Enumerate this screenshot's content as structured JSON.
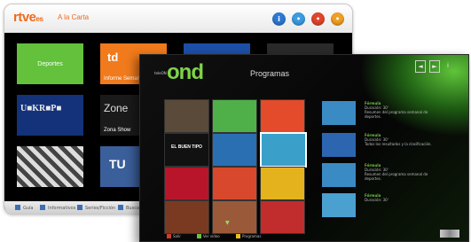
{
  "rtve": {
    "logo": "rtve",
    "logo_suffix": "es",
    "title": "A la Carta",
    "header_icons": [
      {
        "name": "info-icon",
        "glyph": "i",
        "color": "#2e79d4"
      },
      {
        "name": "globe-icon",
        "glyph": "•",
        "color": "#3d9be0"
      },
      {
        "name": "record-icon",
        "glyph": "•",
        "color": "#e0462d"
      },
      {
        "name": "home-icon",
        "glyph": "•",
        "color": "#f0a025"
      }
    ],
    "tiles": [
      {
        "label": "Deportes",
        "bg": "#63c13c"
      },
      {
        "label": "Informe Semanal",
        "bg": "#f07a1c"
      },
      {
        "label": "",
        "bg": "#1d4fa8"
      },
      {
        "label": "",
        "bg": "#2a2a2a"
      },
      {
        "label": "",
        "bg": "#14327a"
      },
      {
        "label": "Zona Show",
        "bg": "#1a1a1a"
      },
      {
        "label": "",
        "bg": "#6b6b6b"
      },
      {
        "label": "",
        "bg": "#3b5f9b"
      }
    ],
    "footer_items": [
      "Guía",
      "Informativos",
      "Series/Ficción",
      "Buscar"
    ]
  },
  "ond": {
    "logo_pre": "teleON",
    "logo": "ond",
    "title": "Programas",
    "top_icons": [
      "◄",
      "►",
      "i"
    ],
    "thumbs": [
      {
        "label": "",
        "bg": "#5a4a3a"
      },
      {
        "label": "",
        "bg": "#4fb04a"
      },
      {
        "label": "",
        "bg": "#e34b2a"
      },
      {
        "label": "",
        "bg": "#6b8b3a"
      },
      {
        "label": "EL BUEN TIPO",
        "bg": "#111111"
      },
      {
        "label": "",
        "bg": "#2b6fb3"
      },
      {
        "label": "",
        "bg": "#3aa0c9"
      },
      {
        "label": "",
        "bg": "#b83a2e"
      },
      {
        "label": "",
        "bg": "#b8152a"
      },
      {
        "label": "",
        "bg": "#d8482c"
      },
      {
        "label": "",
        "bg": "#e4b21d"
      },
      {
        "label": "",
        "bg": "#505050"
      },
      {
        "label": "",
        "bg": "#7a3a22"
      },
      {
        "label": "",
        "bg": "#9a5a3a"
      },
      {
        "label": "",
        "bg": "#c12c2c"
      },
      {
        "label": "",
        "bg": "#1f1f1f"
      }
    ],
    "episodes": [
      {
        "heading": "Fórmula",
        "date": "Duración: 30'",
        "desc": "Resumen del programa semanal de deportes.",
        "bg": "#3a8ac4"
      },
      {
        "heading": "Fórmula",
        "date": "Duración: 30'",
        "desc": "Todos los resultados y la clasificación.",
        "bg": "#2d66b0"
      },
      {
        "heading": "Fórmula",
        "date": "Duración: 30'",
        "desc": "Resumen del programa semanal de deportes.",
        "bg": "#3a8ac4"
      },
      {
        "heading": "Fórmula",
        "date": "Duración: 30'",
        "desc": "",
        "bg": "#4aa0cf"
      }
    ],
    "footer_items": [
      {
        "label": "Salir",
        "color": "#d23a2a"
      },
      {
        "label": "Ver vídeo",
        "color": "#6ec13f"
      },
      {
        "label": "Programas",
        "color": "#e8c020"
      }
    ]
  }
}
